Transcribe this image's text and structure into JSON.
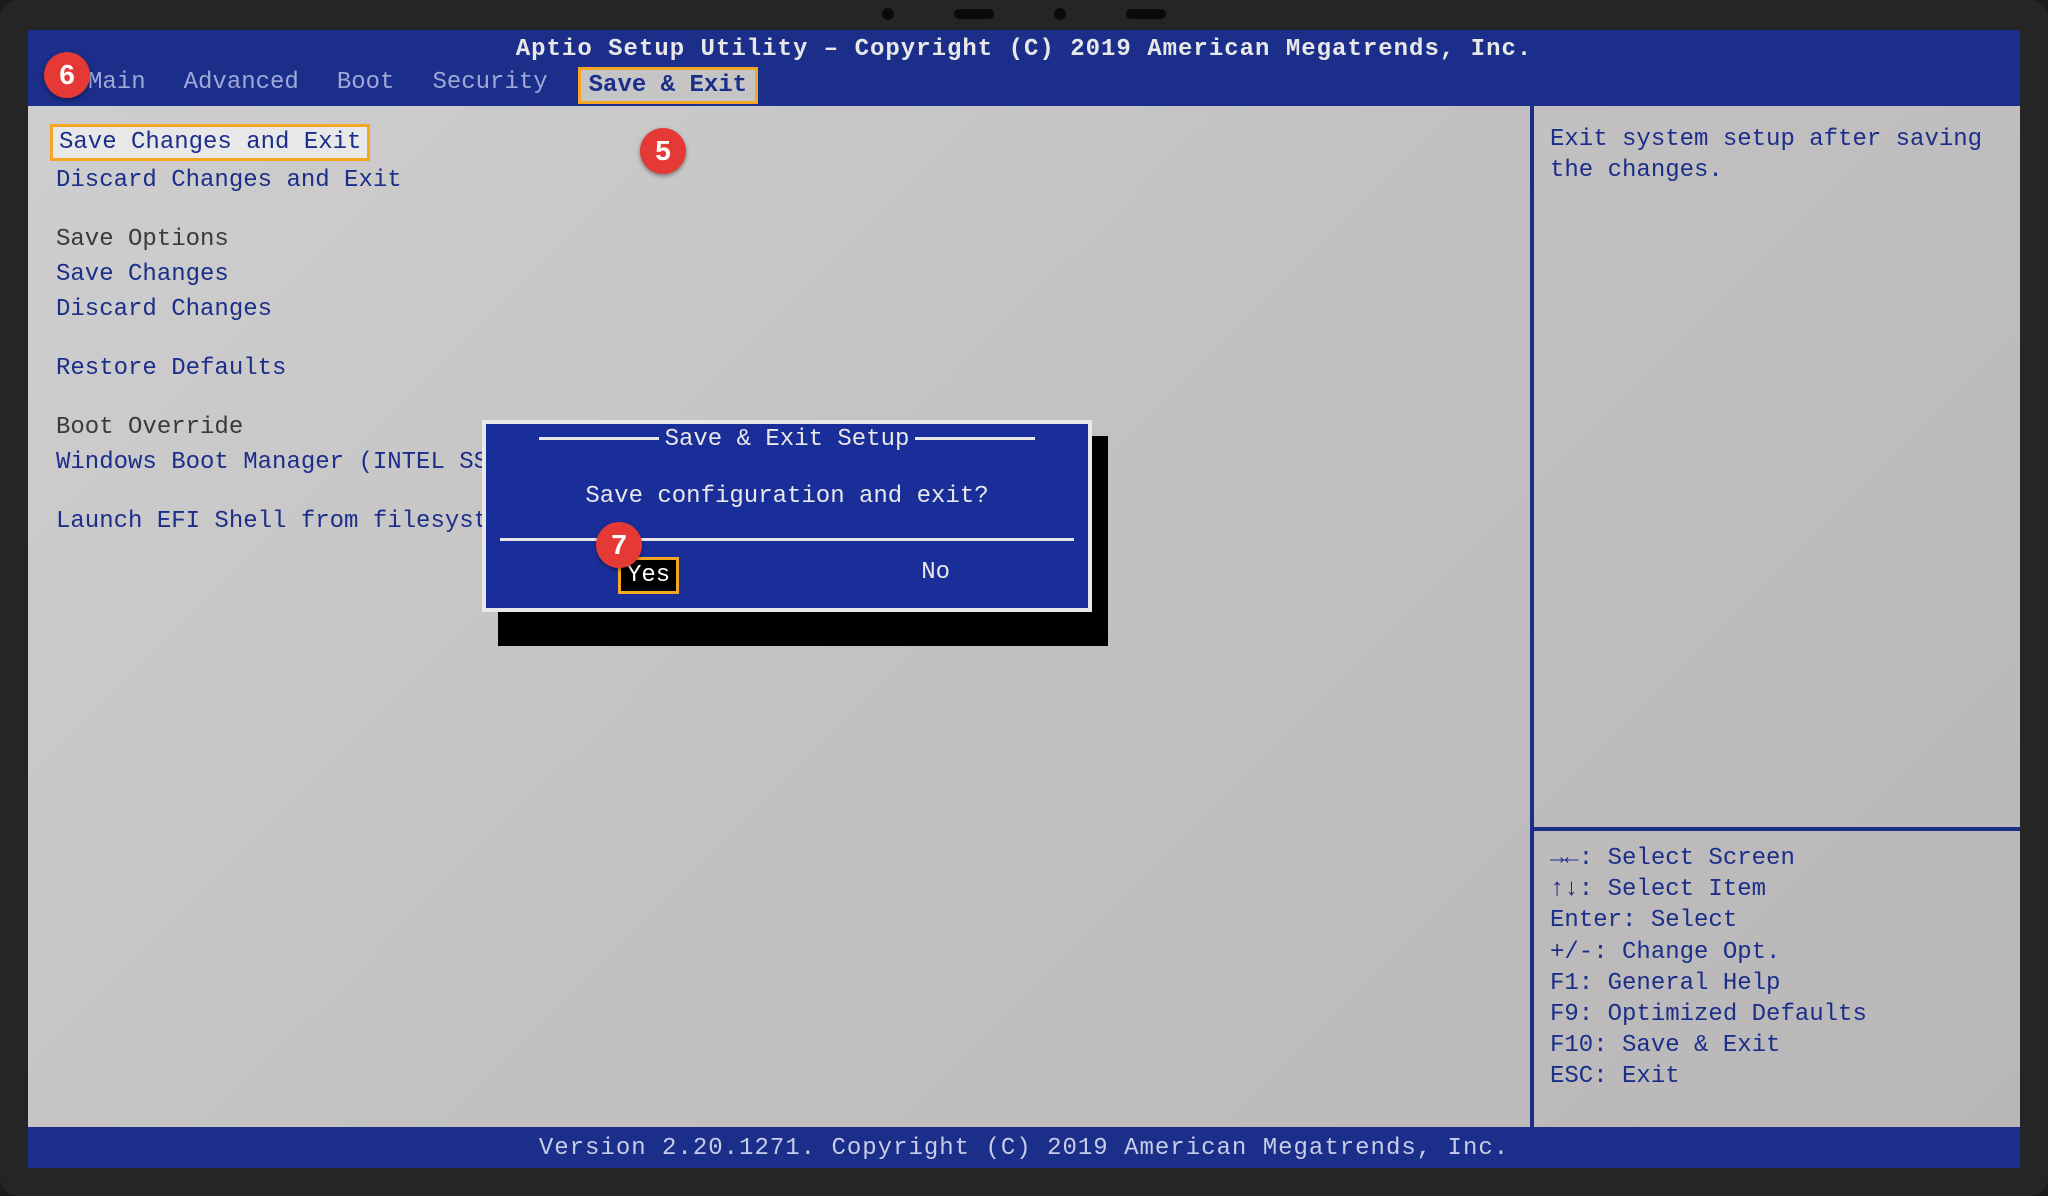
{
  "header": {
    "title": "Aptio Setup Utility – Copyright (C) 2019 American Megatrends, Inc.",
    "tabs": [
      "Main",
      "Advanced",
      "Boot",
      "Security",
      "Save & Exit"
    ]
  },
  "menu": {
    "save_changes_exit": "Save Changes and Exit",
    "discard_changes_exit": "Discard Changes and Exit",
    "save_options_hdr": "Save Options",
    "save_changes": "Save Changes",
    "discard_changes": "Discard Changes",
    "restore_defaults": "Restore Defaults",
    "boot_override_hdr": "Boot Override",
    "windows_boot": "Windows Boot Manager (INTEL SSD",
    "launch_efi": "Launch EFI Shell from filesyste"
  },
  "help": {
    "description": "Exit system setup after saving the changes.",
    "keys": [
      "→←: Select Screen",
      "↑↓: Select Item",
      "Enter: Select",
      "+/-: Change Opt.",
      "F1: General Help",
      "F9: Optimized Defaults",
      "F10: Save & Exit",
      "ESC: Exit"
    ]
  },
  "dialog": {
    "title": "Save & Exit Setup",
    "message": "Save configuration and exit?",
    "yes": "Yes",
    "no": "No"
  },
  "footer": "Version 2.20.1271. Copyright (C) 2019 American Megatrends, Inc.",
  "annotations": {
    "a5": "5",
    "a6": "6",
    "a7": "7"
  }
}
